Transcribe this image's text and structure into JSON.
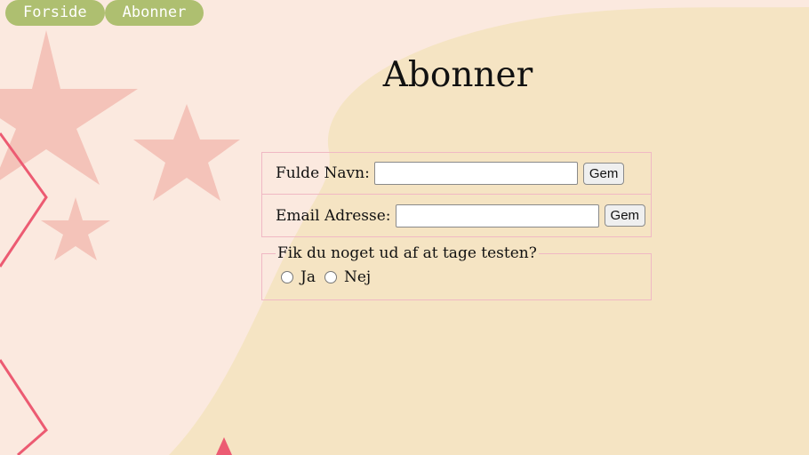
{
  "nav": {
    "items": [
      {
        "label": "Forside"
      },
      {
        "label": "Abonner"
      }
    ]
  },
  "page": {
    "title": "Abonner"
  },
  "form": {
    "name_label": "Fulde Navn:",
    "name_value": "",
    "name_save": "Gem",
    "email_label": "Email Adresse:",
    "email_value": "",
    "email_save": "Gem",
    "question": {
      "legend": "Fik du noget ud af at tage testen?",
      "options": [
        "Ja",
        "Nej"
      ]
    }
  },
  "colors": {
    "background": "#fbe9df",
    "blob": "#f5e4c3",
    "nav": "#aebf70",
    "stars": "#f4c3b9",
    "zigzag": "#ec5b72",
    "border": "#f0b8c4"
  }
}
